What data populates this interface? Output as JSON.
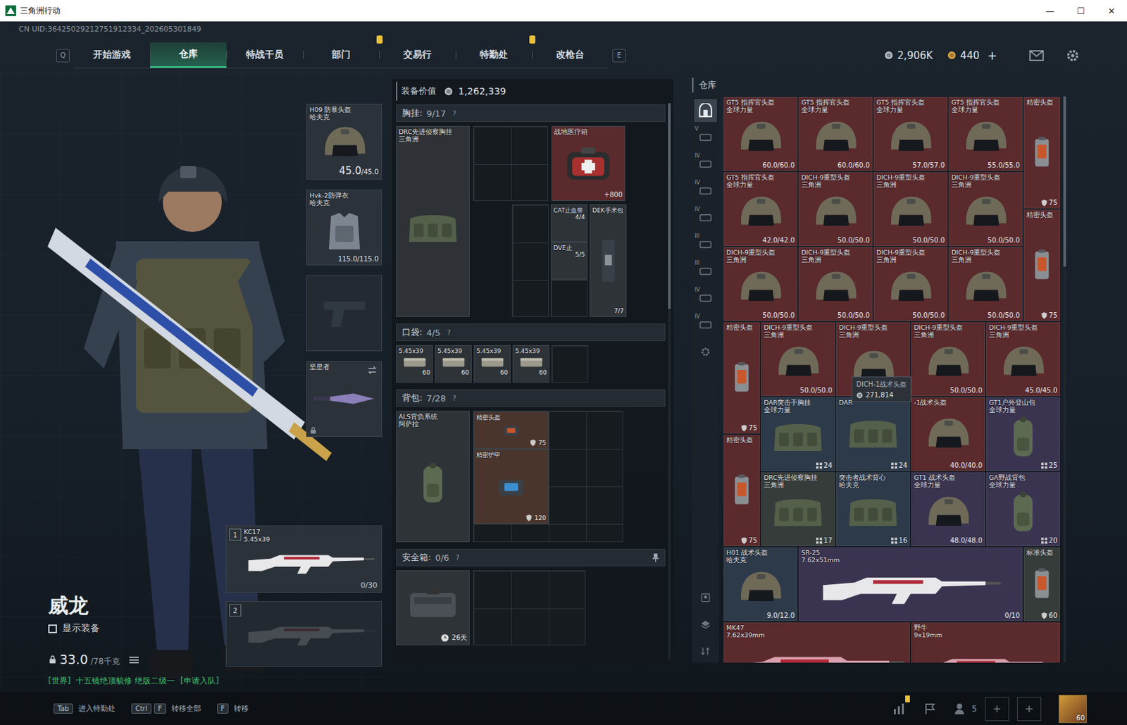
{
  "window": {
    "title": "三角洲行动",
    "controls": [
      "—",
      "☐",
      "✕"
    ]
  },
  "uid": "CN UID:36425029212751912334_202605301849",
  "nav": {
    "prev_key": "Q",
    "next_key": "E",
    "tabs": [
      {
        "label": "开始游戏",
        "selected": false,
        "alert": false
      },
      {
        "label": "仓库",
        "selected": true,
        "alert": false
      },
      {
        "label": "特战干员",
        "selected": false,
        "alert": false
      },
      {
        "label": "部门",
        "selected": false,
        "alert": true
      },
      {
        "label": "交易行",
        "selected": false,
        "alert": false
      },
      {
        "label": "特勤处",
        "selected": false,
        "alert": true
      },
      {
        "label": "改枪台",
        "selected": false,
        "alert": false
      }
    ]
  },
  "currency": {
    "coins": "2,906K",
    "premium": "440",
    "add": "+"
  },
  "character": {
    "name": "威龙",
    "show_gear_label": "显示装备",
    "show_gear": false,
    "weight": "33.0",
    "weight_max": "/78千克"
  },
  "chat": {
    "channel": "[世界]",
    "text": "十五镜绝顶貌修  绝版二级一",
    "action": "[申请入队]"
  },
  "equipment": {
    "helmet": {
      "name": "H09 防暴头盔",
      "brand": "哈夫克",
      "value": "45.0",
      "value_max": "/45.0"
    },
    "armor": {
      "name": "Hvk-2防弹衣",
      "brand": "哈夫克",
      "value": "115.0/115.0"
    },
    "pistol": {
      "empty": true
    },
    "melee": {
      "name": "坚星者"
    },
    "weapons": [
      {
        "slot": "1",
        "name": "KC17",
        "ammo": "5.45x39",
        "mag": "0/30",
        "empty": false
      },
      {
        "slot": "2",
        "name": "",
        "ammo": "",
        "mag": "",
        "empty": true
      }
    ]
  },
  "loadout": {
    "value_label": "装备价值",
    "value": "1,262,339",
    "help": "?",
    "chest": {
      "label": "胸挂:",
      "count": "9/17",
      "rig": {
        "name": "DRC先进侦察胸挂",
        "brand": "三角洲",
        "color": "#2e3236"
      },
      "medkit": {
        "name": "战地医疗箱",
        "value": "+800",
        "color": "#5a2a2d"
      },
      "small": [
        {
          "name": "CAT止血带",
          "value": "4/4"
        },
        {
          "name": "DVE止",
          "value": "5/5"
        }
      ],
      "surgery": {
        "name": "DEK手术包",
        "value": "7/7"
      }
    },
    "pockets": {
      "label": "口袋:",
      "count": "4/5",
      "items": [
        {
          "name": "5.45x39",
          "value": "60"
        },
        {
          "name": "5.45x39",
          "value": "60"
        },
        {
          "name": "5.45x39",
          "value": "60"
        },
        {
          "name": "5.45x39",
          "value": "60"
        }
      ],
      "empty_slots": 1
    },
    "backpack": {
      "label": "背包:",
      "count": "7/28",
      "pack": {
        "name": "ALS背负系统",
        "brand": "阿萨拉"
      },
      "items": [
        {
          "name": "精密头盔",
          "value": "75",
          "kind": "wide"
        },
        {
          "name": "精密护甲",
          "value": "120",
          "kind": "square"
        }
      ]
    },
    "safe": {
      "label": "安全箱:",
      "count": "0/6",
      "time": "26天"
    }
  },
  "warehouse": {
    "title": "仓库",
    "scroll_level": 0.3,
    "home_tab": {
      "selected": true
    },
    "tier_tabs": [
      {
        "tier": "V",
        "selected": false
      },
      {
        "tier": "IV",
        "selected": false
      },
      {
        "tier": "IV",
        "selected": false
      },
      {
        "tier": "IV",
        "selected": false
      },
      {
        "tier": "III",
        "selected": false
      },
      {
        "tier": "III",
        "selected": false
      },
      {
        "tier": "IV",
        "selected": false
      },
      {
        "tier": "IV",
        "selected": false
      }
    ],
    "tooltip": {
      "title": "DICH-1战术头盔",
      "value": "271,814"
    },
    "items": [
      {
        "name": "GT5 指挥官头盔",
        "brand": "全球力量",
        "value": "60.0/60.0",
        "kind": "helmet",
        "color": "#5a2a2d",
        "hovered": false
      },
      {
        "name": "GT5 指挥官头盔",
        "brand": "全球力量",
        "value": "60.0/60.0",
        "kind": "helmet",
        "color": "#5a2a2d",
        "hovered": false
      },
      {
        "name": "GT5 指挥官头盔",
        "brand": "全球力量",
        "value": "57.0/57.0",
        "kind": "helmet",
        "color": "#5a2a2d",
        "hovered": false
      },
      {
        "name": "GT5 指挥官头盔",
        "brand": "全球力量",
        "value": "55.0/55.0",
        "kind": "helmet",
        "color": "#5a2a2d",
        "hovered": false
      },
      {
        "name": "精密头盔",
        "brand": "",
        "value": "75",
        "kind": "case",
        "color": "#5a2a2d",
        "hovered": false
      },
      {
        "name": "GT5 指挥官头盔",
        "brand": "全球力量",
        "value": "42.0/42.0",
        "kind": "helmet",
        "color": "#5a2a2d",
        "hovered": false
      },
      {
        "name": "DICH-9重型头盔",
        "brand": "三角洲",
        "value": "50.0/50.0",
        "kind": "helmet",
        "color": "#5a2a2d",
        "hovered": false
      },
      {
        "name": "DICH-9重型头盔",
        "brand": "三角洲",
        "value": "50.0/50.0",
        "kind": "helmet",
        "color": "#5a2a2d",
        "hovered": false
      },
      {
        "name": "DICH-9重型头盔",
        "brand": "三角洲",
        "value": "50.0/50.0",
        "kind": "helmet",
        "color": "#5a2a2d",
        "hovered": false
      },
      {
        "name": "精密头盔",
        "brand": "",
        "value": "75",
        "kind": "case",
        "color": "#5a2a2d",
        "hovered": false
      },
      {
        "name": "DICH-9重型头盔",
        "brand": "三角洲",
        "value": "50.0/50.0",
        "kind": "helmet",
        "color": "#5a2a2d",
        "hovered": false
      },
      {
        "name": "DICH-9重型头盔",
        "brand": "三角洲",
        "value": "50.0/50.0",
        "kind": "helmet",
        "color": "#5a2a2d",
        "hovered": false
      },
      {
        "name": "DICH-9重型头盔",
        "brand": "三角洲",
        "value": "50.0/50.0",
        "kind": "helmet",
        "color": "#5a2a2d",
        "hovered": false
      },
      {
        "name": "DICH-9重型头盔",
        "brand": "三角洲",
        "value": "50.0/50.0",
        "kind": "helmet",
        "color": "#5a2a2d",
        "hovered": false
      },
      {
        "name": "精密头盔",
        "brand": "",
        "value": "75",
        "kind": "case",
        "color": "#5a2a2d",
        "hovered": false
      },
      {
        "name": "DICH-9重型头盔",
        "brand": "三角洲",
        "value": "50.0/50.0",
        "kind": "helmet",
        "color": "#5a2a2d",
        "hovered": false
      },
      {
        "name": "DICH-9重型头盔",
        "brand": "三角洲",
        "value": "",
        "kind": "helmet",
        "color": "#5a2a2d",
        "hovered": true
      },
      {
        "name": "DICH-9重型头盔",
        "brand": "三角洲",
        "value": "50.0/50.0",
        "kind": "helmet",
        "color": "#5a2a2d",
        "hovered": false
      },
      {
        "name": "DICH-9重型头盔",
        "brand": "三角洲",
        "value": "45.0/45.0",
        "kind": "helmet",
        "color": "#5a2a2d",
        "hovered": false
      },
      {
        "name": "DAR突击手胸挂",
        "brand": "全球力量",
        "value": "24",
        "kind": "rig",
        "color": "#2d3a4a",
        "hovered": false
      },
      {
        "name": "DAR",
        "brand": "",
        "value": "24",
        "kind": "rig",
        "color": "#2d3a4a",
        "hovered": false
      },
      {
        "name": "-1战术头盔",
        "brand": "",
        "value": "40.0/40.0",
        "kind": "helmet",
        "color": "#5a2a2d",
        "hovered": false
      },
      {
        "name": "GT1户外登山包",
        "brand": "全球力量",
        "value": "25",
        "kind": "bag",
        "color": "#3b3450",
        "hovered": false
      },
      {
        "name": "精密头盔",
        "brand": "",
        "value": "75",
        "kind": "case",
        "color": "#5a2a2d",
        "hovered": false
      },
      {
        "name": "DRC先进侦察胸挂",
        "brand": "三角洲",
        "value": "17",
        "kind": "rig",
        "color": "#363c3a",
        "hovered": false
      },
      {
        "name": "突击者战术背心",
        "brand": "哈夫克",
        "value": "16",
        "kind": "rig",
        "color": "#2d3a4a",
        "hovered": false
      },
      {
        "name": "GT1 战术头盔",
        "brand": "全球力量",
        "value": "48.0/48.0",
        "kind": "helmet",
        "color": "#3b3450",
        "hovered": false
      },
      {
        "name": "GA野战背包",
        "brand": "全球力量",
        "value": "20",
        "kind": "bag",
        "color": "#3b3450",
        "hovered": false
      },
      {
        "name": "H01 战术头盔",
        "brand": "哈夫克",
        "value": "9.0/12.0",
        "kind": "helmet",
        "color": "#2d3a4a",
        "hovered": false
      },
      {
        "name": "SR-25",
        "brand": "7.62x51mm",
        "value": "0/10",
        "kind": "rifle",
        "color": "#3b3450",
        "hovered": false
      },
      {
        "name": "标准头盔",
        "brand": "",
        "value": "60",
        "kind": "case-short",
        "color": "#363c3a",
        "hovered": false
      },
      {
        "name": "MK47",
        "brand": "7.62x39mm",
        "value": "",
        "kind": "carbine",
        "color": "#5a2a2d",
        "hovered": false
      },
      {
        "name": "野牛",
        "brand": "9x19mm",
        "value": "",
        "kind": "smg",
        "color": "#5a2a2d",
        "hovered": false
      }
    ]
  },
  "bottom_bar": {
    "hints": [
      {
        "keys": [
          "Tab"
        ],
        "label": "进入特勤处"
      },
      {
        "keys": [
          "Ctrl",
          "F"
        ],
        "label": "转移全部"
      },
      {
        "keys": [
          "F"
        ],
        "label": "转移"
      }
    ],
    "friends": "5",
    "level": "60"
  }
}
